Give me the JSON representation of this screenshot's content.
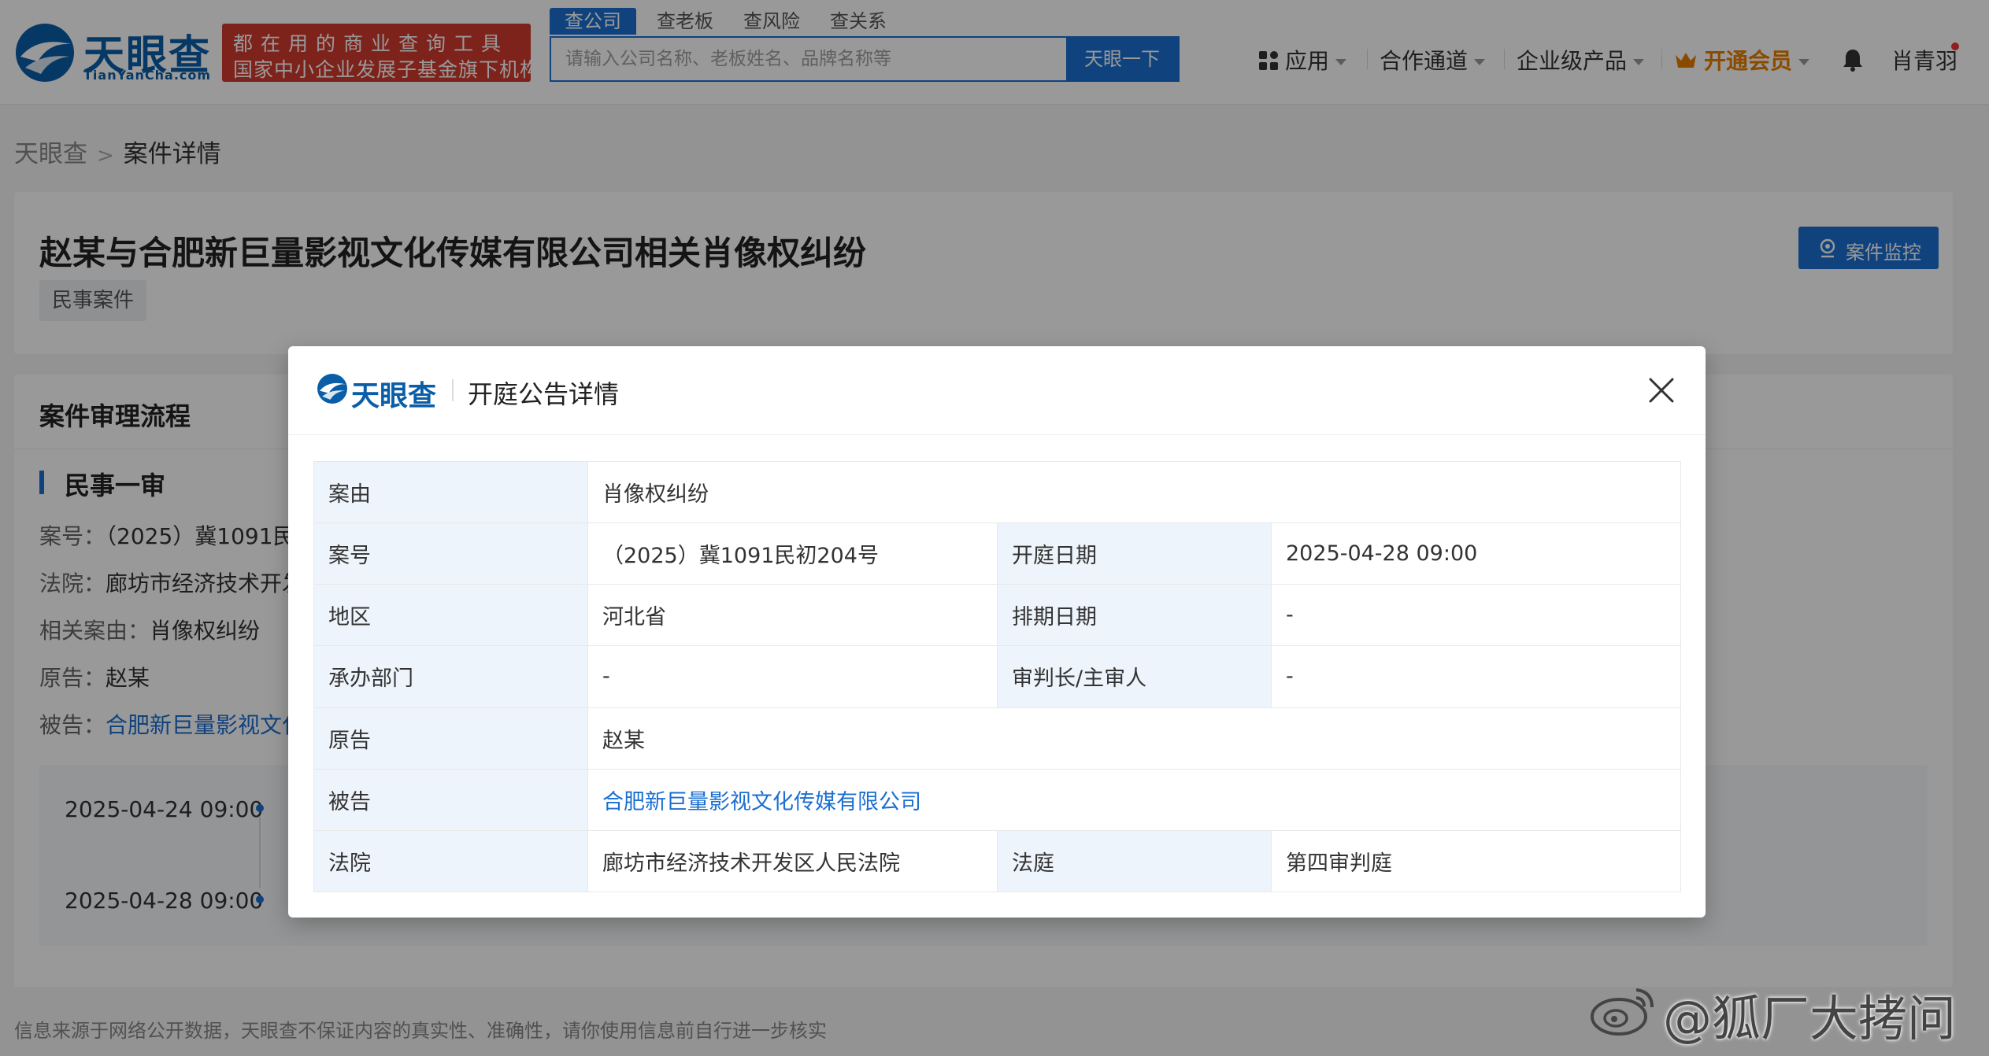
{
  "header": {
    "logo_text": "天眼查",
    "logo_domain": "TianYanCha.com",
    "slogan_line1": "都在用的商业查询工具",
    "slogan_line2": "国家中小企业发展子基金旗下机构",
    "search_tabs": [
      "查公司",
      "查老板",
      "查风险",
      "查关系"
    ],
    "search_placeholder": "请输入公司名称、老板姓名、品牌名称等",
    "search_button": "天眼一下",
    "nav": {
      "apps": "应用",
      "partner": "合作通道",
      "enterprise": "企业级产品",
      "vip": "开通会员",
      "user": "肖青羽"
    }
  },
  "breadcrumb": {
    "home": "天眼查",
    "current": "案件详情"
  },
  "case": {
    "title": "赵某与合肥新巨量影视文化传媒有限公司相关肖像权纠纷",
    "tag": "民事案件",
    "monitor_button": "案件监控"
  },
  "process": {
    "title": "案件审理流程",
    "stage": "民事一审",
    "case_no_label": "案号：",
    "case_no_value": "（2025）冀1091民",
    "court_label": "法院：",
    "court_value": "廊坊市经济技术开发",
    "cause_label": "相关案由：",
    "cause_value": "肖像权纠纷",
    "plaintiff_label": "原告：",
    "plaintiff_value": "赵某",
    "defendant_label": "被告：",
    "defendant_value": "合肥新巨量影视文化",
    "timeline": [
      "2025-04-24 09:00",
      "2025-04-28 09:00"
    ]
  },
  "footer": {
    "note": "信息来源于网络公开数据，天眼查不保证内容的真实性、准确性，请你使用信息前自行进一步核实",
    "watermark": "@狐厂大拷问"
  },
  "modal": {
    "logo_text": "天眼查",
    "title": "开庭公告详情",
    "rows": {
      "cause_k": "案由",
      "cause_v": "肖像权纠纷",
      "caseno_k": "案号",
      "caseno_v": "（2025）冀1091民初204号",
      "hearing_k": "开庭日期",
      "hearing_v": "2025-04-28 09:00",
      "region_k": "地区",
      "region_v": "河北省",
      "schedule_k": "排期日期",
      "schedule_v": "-",
      "dept_k": "承办部门",
      "dept_v": "-",
      "judge_k": "审判长/主审人",
      "judge_v": "-",
      "plaintiff_k": "原告",
      "plaintiff_v": "赵某",
      "defendant_k": "被告",
      "defendant_v": "合肥新巨量影视文化传媒有限公司",
      "court_k": "法院",
      "court_v": "廊坊市经济技术开发区人民法院",
      "room_k": "法庭",
      "room_v": "第四审判庭"
    }
  },
  "colors": {
    "brand": "#0a5ea8",
    "primary": "#1b6fd1",
    "slogan_bg": "#d13b2e",
    "vip": "#e67e00"
  }
}
